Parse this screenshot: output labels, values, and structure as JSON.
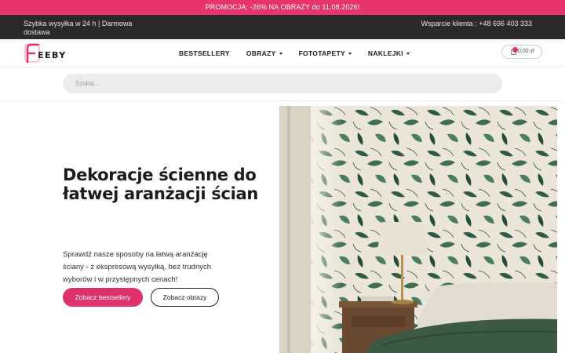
{
  "promo": {
    "text": "PROMOCJA: -26% NA OBRAZY do 11.08.2026!"
  },
  "topbar": {
    "left_text": "Szybka wysyłka w 24 h   |   Darmowa dostawa",
    "right_text": "Wsparcie klienta : +48 696 403 333"
  },
  "header": {
    "logo_text": "EEBY",
    "nav": [
      {
        "label": "BESTSELLERY",
        "has_dropdown": false
      },
      {
        "label": "OBRAZY",
        "has_dropdown": true
      },
      {
        "label": "FOTOTAPETY",
        "has_dropdown": true
      },
      {
        "label": "NAKLEJKI",
        "has_dropdown": true
      }
    ],
    "cart": {
      "badge_count": "0",
      "price": "0,00 zł"
    }
  },
  "search": {
    "placeholder": "Szukaj..."
  },
  "hero": {
    "title": "Dekoracje ścienne do łatwej aranżacji ścian",
    "description": "Sprawdź nasze sposoby na łatwą aranżację ściany - z ekspresową wysyłką, bez trudnych wyborów i w przystępnych cenach!",
    "primary_button": "Zobacz bestsellery",
    "secondary_button": "Zobacz obrazy"
  },
  "colors": {
    "brand_pink": "#e8336d",
    "topbar_dark": "#2b2929",
    "search_bg": "#ececec"
  },
  "icons": [
    "logo-mark-icon",
    "caret-down-icon",
    "shopping-bag-icon"
  ]
}
